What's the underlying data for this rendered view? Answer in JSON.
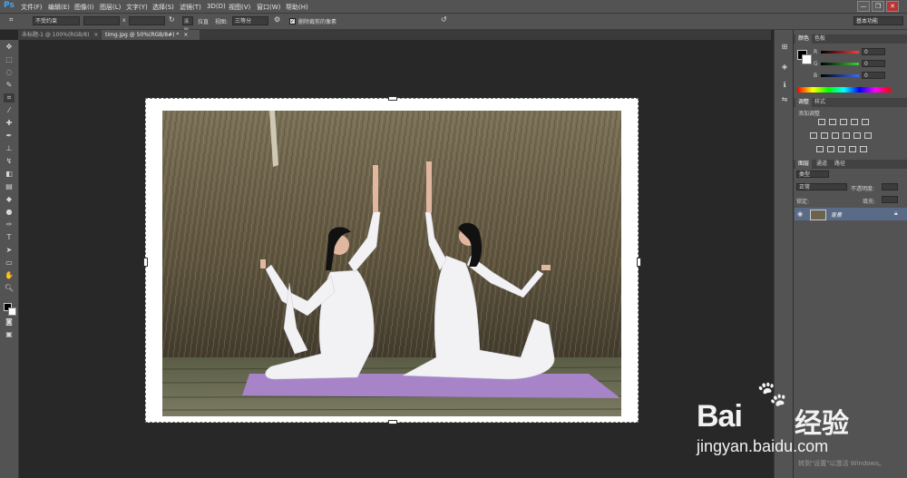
{
  "app": {
    "logo": "Ps"
  },
  "menu": [
    "文件(F)",
    "编辑(E)",
    "图像(I)",
    "图层(L)",
    "文字(Y)",
    "选择(S)",
    "滤镜(T)",
    "3D(D)",
    "视图(V)",
    "窗口(W)",
    "帮助(H)"
  ],
  "window_controls": {
    "minimize": "—",
    "restore": "❐",
    "close": "✕"
  },
  "options": {
    "ratio_value": "不受约束",
    "x_sep": "x",
    "clear_label": "清除",
    "straighten_label": "拉直",
    "view_label": "视图:",
    "view_value": "三等分",
    "delete_pixels_label": "删除裁剪的像素",
    "workspace_value": "基本功能"
  },
  "tabs": [
    {
      "label": "未标题-1 @ 100%(RGB/8)",
      "close": "×"
    },
    {
      "label": "timg.jpg @ 50%(RGB/8#) *",
      "close": "×"
    }
  ],
  "tools": [
    "move-tool",
    "marquee-tool",
    "lasso-tool",
    "quick-select-tool",
    "crop-tool",
    "eyedropper-tool",
    "healing-tool",
    "brush-tool",
    "stamp-tool",
    "history-brush-tool",
    "eraser-tool",
    "gradient-tool",
    "blur-tool",
    "dodge-tool",
    "pen-tool",
    "type-tool",
    "path-select-tool",
    "shape-tool",
    "hand-tool",
    "zoom-tool"
  ],
  "color_panel": {
    "tabs": [
      "颜色",
      "色板"
    ],
    "channels": [
      {
        "name": "R",
        "value": "0",
        "color": "#ff3b3b"
      },
      {
        "name": "G",
        "value": "0",
        "color": "#3bd13b"
      },
      {
        "name": "B",
        "value": "0",
        "color": "#3b6bff"
      }
    ]
  },
  "adjust_panel": {
    "tabs": [
      "调整",
      "样式"
    ],
    "heading": "添加调整"
  },
  "layers_panel": {
    "tabs": [
      "图层",
      "通道",
      "路径"
    ],
    "kind_label": "类型",
    "blend_mode": "正常",
    "opacity_label": "不透明度:",
    "lock_label": "锁定:",
    "fill_label": "填充:",
    "layer_name": "背景"
  },
  "watermark": {
    "brand": "Bai",
    "brand_cn": "经验",
    "url": "jingyan.baidu.com",
    "activate_text": "转到\"设置\"以激活 Windows。"
  },
  "colors": {
    "chrome": "#535353",
    "canvas_bg": "#282828",
    "accent": "#4aa3e8",
    "mat": "#a784c8"
  }
}
